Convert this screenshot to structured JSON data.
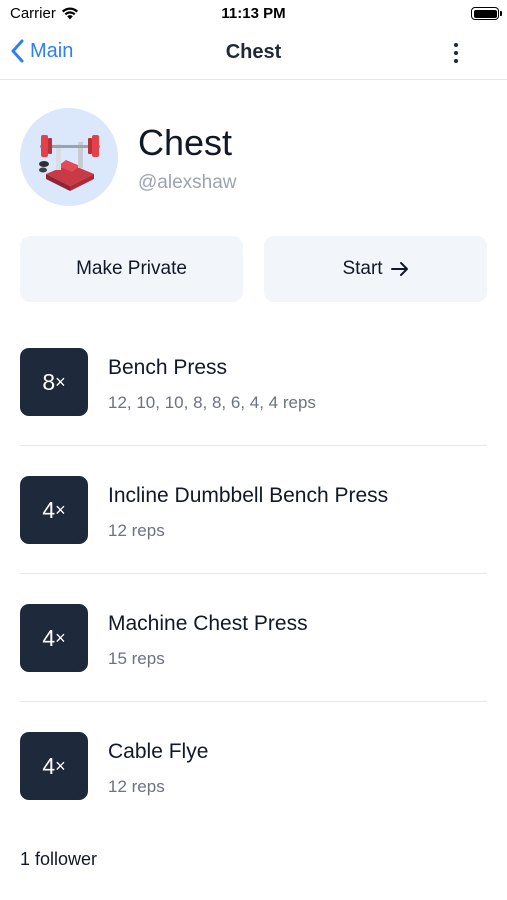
{
  "status_bar": {
    "carrier": "Carrier",
    "time": "11:13 PM"
  },
  "nav": {
    "back_label": "Main",
    "title": "Chest"
  },
  "profile": {
    "title": "Chest",
    "handle": "@alexshaw"
  },
  "actions": {
    "make_private_label": "Make Private",
    "start_label": "Start"
  },
  "exercises": [
    {
      "sets": "8",
      "name": "Bench Press",
      "reps": "12, 10, 10, 8, 8, 6, 4, 4 reps"
    },
    {
      "sets": "4",
      "name": "Incline Dumbbell Bench Press",
      "reps": "12 reps"
    },
    {
      "sets": "4",
      "name": "Machine Chest Press",
      "reps": "15 reps"
    },
    {
      "sets": "4",
      "name": "Cable Flye",
      "reps": "12 reps"
    }
  ],
  "followers_text": "1 follower",
  "colors": {
    "accent": "#2f80ed",
    "badge_bg": "#1e293b",
    "button_bg": "#f2f5f9",
    "avatar_bg": "#dbe7fb"
  },
  "icons": {
    "back": "chevron-left-icon",
    "more": "vertical-ellipsis-icon",
    "start": "arrow-right-icon",
    "avatar": "bench-press-icon"
  }
}
